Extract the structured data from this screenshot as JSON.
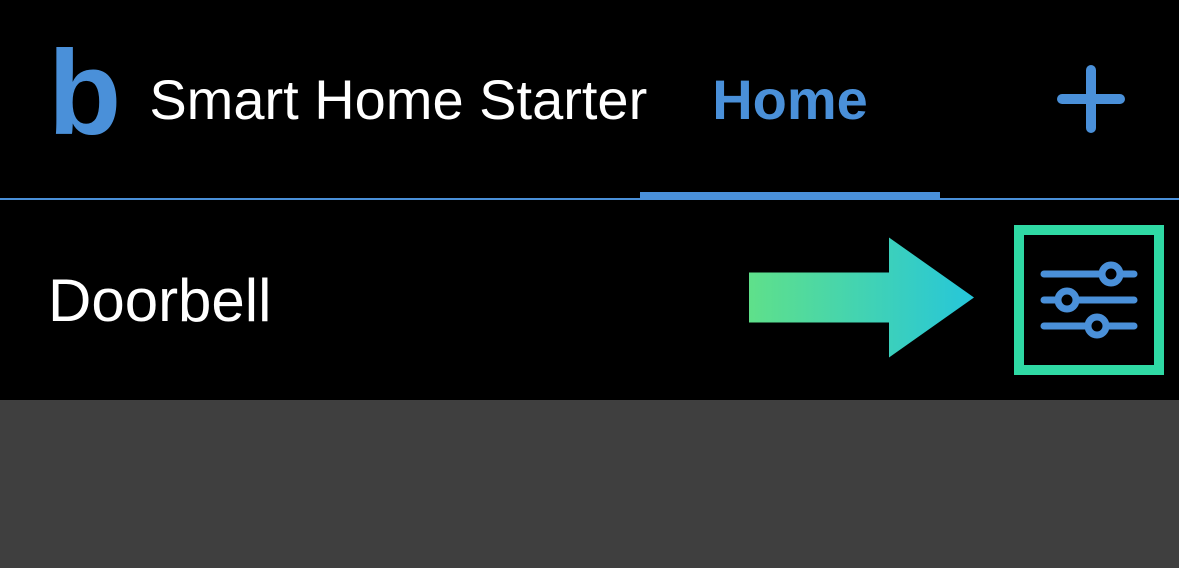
{
  "header": {
    "logo_letter": "b",
    "title": "Smart Home Starter",
    "active_tab": "Home",
    "add_icon_name": "plus-icon"
  },
  "device": {
    "name": "Doorbell",
    "settings_icon_name": "sliders-icon"
  },
  "annotation": {
    "arrow_icon_name": "arrow-right-icon",
    "highlight_color": "#2fd9a4"
  },
  "colors": {
    "accent": "#4A90D9",
    "highlight_green": "#2fd9a4",
    "highlight_teal": "#26c6da"
  }
}
